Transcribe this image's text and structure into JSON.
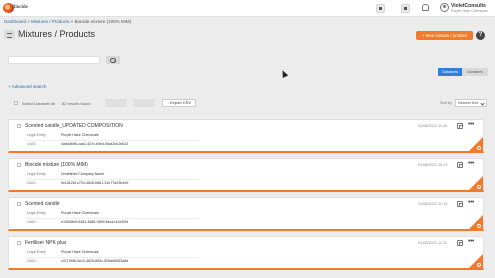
{
  "header": {
    "logo_text": "Biocide",
    "user_name": "VioletConsults",
    "user_org": "Purple Haze Chemicals"
  },
  "breadcrumb": {
    "dashboard": "Dashboard",
    "sep1": " » ",
    "mixtures": "Mixtures / Products",
    "sep2": " » ",
    "current": "Biocide mixture (100% MIM)"
  },
  "page": {
    "title": "Mixtures / Products",
    "new_button": "+ New mixture / product",
    "help": "?"
  },
  "search": {
    "placeholder": "",
    "advanced_label": "+ Advanced search"
  },
  "view_toggle": {
    "datasets": "Datasets",
    "dossiers": "Dossiers"
  },
  "toolbar": {
    "select_all": "Select Datasets all",
    "results": "82 results found",
    "export_icon": "download-icon",
    "export": "Export CSV",
    "sort_label": "Sort by",
    "sort_value": "Newest first"
  },
  "cards": [
    {
      "title": "Scented candle_UPDATED COMPOSITION",
      "date": "01/08/2021 11:40",
      "legal_label": "Legal Entity",
      "legal_value": "Purple Haze Chemicals",
      "uuid_label": "UUID",
      "uuid_value": "4ada4b5b-caa1-407c-b9e4-f5da39c2b622"
    },
    {
      "title": "Biocide mixture (100% MIM)",
      "date": "01/08/2021 10:12",
      "legal_label": "Legal Entity",
      "legal_value": "Undefined Company Name",
      "uuid_label": "UUID",
      "uuid_value": "9c18126f-c704-4828-b861-31e77a23b4d9"
    },
    {
      "title": "Scented candle",
      "date": "01/08/2021 11:13",
      "legal_label": "Legal Entity",
      "legal_value": "Purple Haze Chemicals",
      "uuid_label": "UUID",
      "uuid_value": "e15508e9-0483-4686-9989-8bc1c42d2f94"
    },
    {
      "title": "Fertiliser NPK plus",
      "date": "01/08/2021 11:12",
      "legal_label": "Legal Entity",
      "legal_value": "Purple Haze Chemicals",
      "uuid_label": "UUID",
      "uuid_value": "c37199f8-0ec3-4625-859c-505a9d053a8d"
    }
  ],
  "colors": {
    "accent": "#f47a2a",
    "primary": "#2f7ed8",
    "link": "#2f6aa8"
  }
}
